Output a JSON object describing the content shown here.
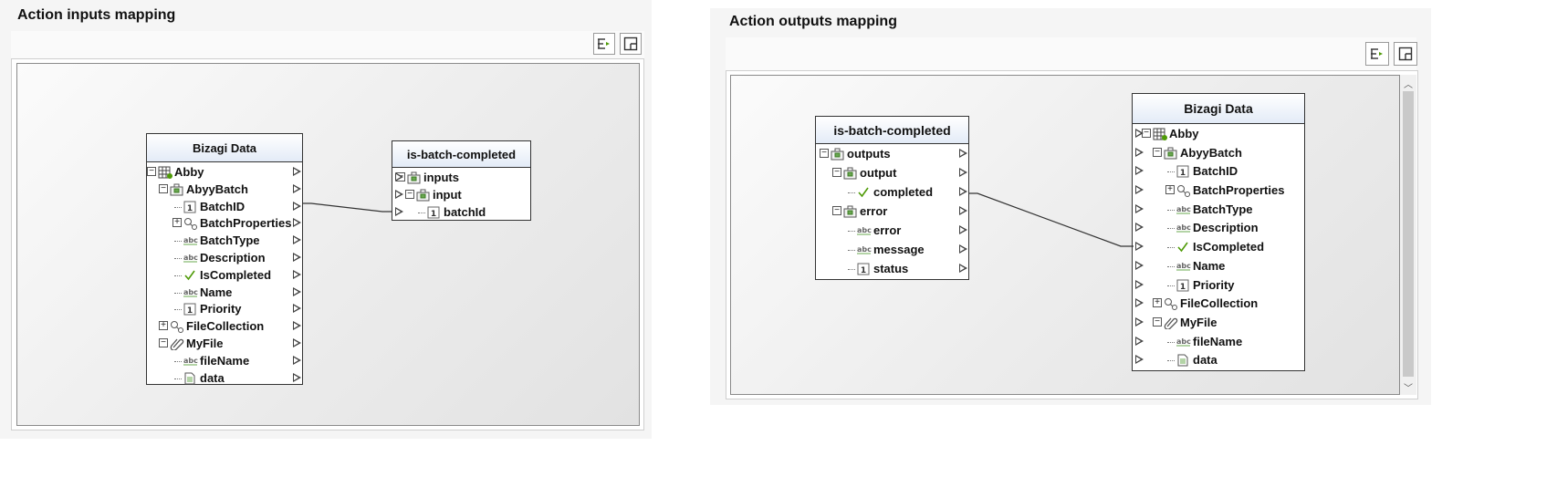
{
  "inputs_panel": {
    "title": "Action inputs mapping",
    "toolbar": {
      "layout_icon": "auto-layout-icon",
      "fit_icon": "fit-window-icon"
    },
    "source_node": {
      "title": "Bizagi Data",
      "rows": [
        {
          "label": "Abby",
          "icon": "entity-table-icon",
          "expander": "−"
        },
        {
          "label": "AbyyBatch",
          "icon": "entity-icon",
          "expander": "−"
        },
        {
          "label": "BatchID",
          "icon": "number-icon"
        },
        {
          "label": "BatchProperties",
          "icon": "relation-icon",
          "expander": "+"
        },
        {
          "label": "BatchType",
          "icon": "text-icon"
        },
        {
          "label": "Description",
          "icon": "text-icon"
        },
        {
          "label": "IsCompleted",
          "icon": "boolean-check-icon"
        },
        {
          "label": "Name",
          "icon": "text-icon"
        },
        {
          "label": "Priority",
          "icon": "number-icon"
        },
        {
          "label": "FileCollection",
          "icon": "relation-icon",
          "expander": "+"
        },
        {
          "label": "MyFile",
          "icon": "attachment-icon",
          "expander": "−"
        },
        {
          "label": "fileName",
          "icon": "text-icon"
        },
        {
          "label": "data",
          "icon": "file-icon"
        }
      ]
    },
    "target_node": {
      "title": "is-batch-completed",
      "rows": [
        {
          "label": "inputs",
          "icon": "entity-icon",
          "expander": "−"
        },
        {
          "label": "input",
          "icon": "entity-icon",
          "expander": "−"
        },
        {
          "label": "batchId",
          "icon": "number-icon"
        }
      ]
    },
    "mapping": {
      "from": "BatchID",
      "to": "batchId"
    }
  },
  "outputs_panel": {
    "title": "Action outputs mapping",
    "toolbar": {
      "layout_icon": "auto-layout-icon",
      "fit_icon": "fit-window-icon"
    },
    "source_node": {
      "title": "is-batch-completed",
      "rows": [
        {
          "label": "outputs",
          "icon": "entity-icon",
          "expander": "−"
        },
        {
          "label": "output",
          "icon": "entity-icon",
          "expander": "−"
        },
        {
          "label": "completed",
          "icon": "boolean-check-icon"
        },
        {
          "label": "error",
          "icon": "entity-icon",
          "expander": "−"
        },
        {
          "label": "error",
          "icon": "text-icon"
        },
        {
          "label": "message",
          "icon": "text-icon"
        },
        {
          "label": "status",
          "icon": "number-icon"
        }
      ]
    },
    "target_node": {
      "title": "Bizagi Data",
      "rows": [
        {
          "label": "Abby",
          "icon": "entity-table-icon",
          "expander": "−"
        },
        {
          "label": "AbyyBatch",
          "icon": "entity-icon",
          "expander": "−"
        },
        {
          "label": "BatchID",
          "icon": "number-icon"
        },
        {
          "label": "BatchProperties",
          "icon": "relation-icon",
          "expander": "+"
        },
        {
          "label": "BatchType",
          "icon": "text-icon"
        },
        {
          "label": "Description",
          "icon": "text-icon"
        },
        {
          "label": "IsCompleted",
          "icon": "boolean-check-icon"
        },
        {
          "label": "Name",
          "icon": "text-icon"
        },
        {
          "label": "Priority",
          "icon": "number-icon"
        },
        {
          "label": "FileCollection",
          "icon": "relation-icon",
          "expander": "+"
        },
        {
          "label": "MyFile",
          "icon": "attachment-icon",
          "expander": "−"
        },
        {
          "label": "fileName",
          "icon": "text-icon"
        },
        {
          "label": "data",
          "icon": "file-icon"
        }
      ]
    },
    "mapping": {
      "from": "completed",
      "to": "IsCompleted"
    }
  },
  "colors": {
    "header_gradient_end": "#e3ebf7",
    "accent_green": "#4e9a06",
    "line": "#333333"
  }
}
